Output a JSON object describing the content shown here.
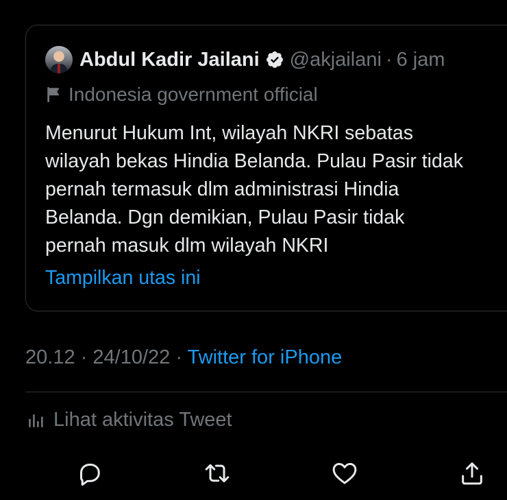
{
  "quoted_tweet": {
    "author_name": "Abdul Kadir Jailani",
    "handle": "@akjailani",
    "separator": "·",
    "time": "6 jam",
    "label": "Indonesia government official",
    "text_lines": [
      "Menurut Hukum Int, wilayah NKRI sebatas",
      "wilayah bekas Hindia Belanda. Pulau Pasir tidak",
      "pernah termasuk dlm administrasi Hindia",
      "Belanda. Dgn demikian, Pulau Pasir tidak",
      "pernah masuk dlm wilayah NKRI"
    ],
    "show_thread": "Tampilkan utas ini"
  },
  "meta": {
    "time": "20.12",
    "sep1": "·",
    "date": "24/10/22",
    "sep2": "·",
    "source": "Twitter for iPhone"
  },
  "activity": {
    "label": "Lihat aktivitas Tweet"
  },
  "icons": {
    "verified": "verified-badge-icon",
    "label_flag": "flag-icon",
    "stats": "bar-chart-icon",
    "actions": [
      "reply-icon",
      "retweet-icon",
      "like-icon",
      "share-icon"
    ]
  },
  "colors": {
    "background": "#000000",
    "text_primary": "#e7e9ea",
    "text_secondary": "#71767b",
    "accent": "#1d9bf0",
    "border": "#2f3336"
  }
}
